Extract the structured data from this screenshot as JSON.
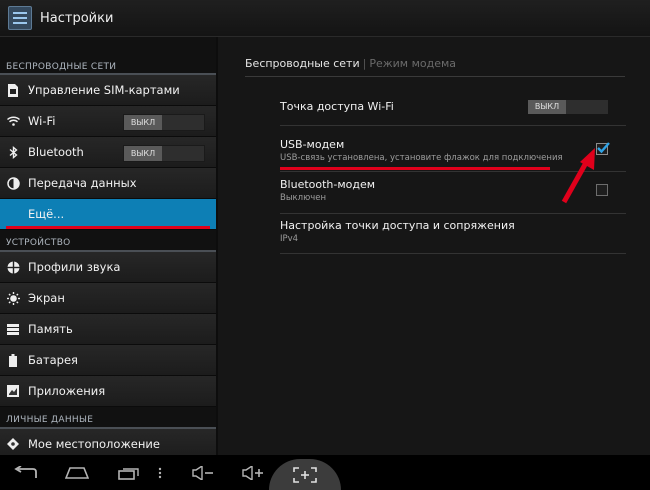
{
  "actionbar": {
    "title": "Настройки",
    "icon": "settings-sliders-icon"
  },
  "sidebar": {
    "sections": [
      {
        "header": "БЕСПРОВОДНЫЕ СЕТИ"
      },
      {
        "header": "УСТРОЙСТВО"
      },
      {
        "header": "ЛИЧНЫЕ ДАННЫЕ"
      }
    ],
    "items": [
      {
        "label": "Управление SIM-картами",
        "icon": "sim-card-icon"
      },
      {
        "label": "Wi-Fi",
        "icon": "wifi-icon",
        "toggle": "ВЫКЛ"
      },
      {
        "label": "Bluetooth",
        "icon": "bluetooth-icon",
        "toggle": "ВЫКЛ"
      },
      {
        "label": "Передача данных",
        "icon": "data-usage-icon"
      },
      {
        "label": "Ещё...",
        "icon": ""
      },
      {
        "label": "Профили звука",
        "icon": "sound-icon"
      },
      {
        "label": "Экран",
        "icon": "display-icon"
      },
      {
        "label": "Память",
        "icon": "storage-icon"
      },
      {
        "label": "Батарея",
        "icon": "battery-icon"
      },
      {
        "label": "Приложения",
        "icon": "apps-icon"
      },
      {
        "label": "Мое местоположение",
        "icon": "location-icon"
      }
    ]
  },
  "main": {
    "tabs": [
      "Беспроводные сети",
      "Режим модема"
    ],
    "rows": [
      {
        "title": "Точка доступа Wi-Fi",
        "subtitle": "",
        "toggle": "ВЫКЛ"
      },
      {
        "title": "USB-модем",
        "subtitle": "USB-связь установлена, установите флажок для подключения",
        "checked": true
      },
      {
        "title": "Bluetooth-модем",
        "subtitle": "Выключен",
        "checked": false
      },
      {
        "title": "Настройка точки доступа и сопряжения",
        "subtitle": "IPv4"
      }
    ]
  },
  "navbar": {
    "buttons": [
      "back-icon",
      "home-icon",
      "recent-apps-icon",
      "screenshot-icon",
      "volume-down-icon",
      "volume-up-icon",
      "screen-capture-icon"
    ]
  },
  "colors": {
    "accent": "#0d7fb5",
    "highlight": "#e0001b"
  }
}
